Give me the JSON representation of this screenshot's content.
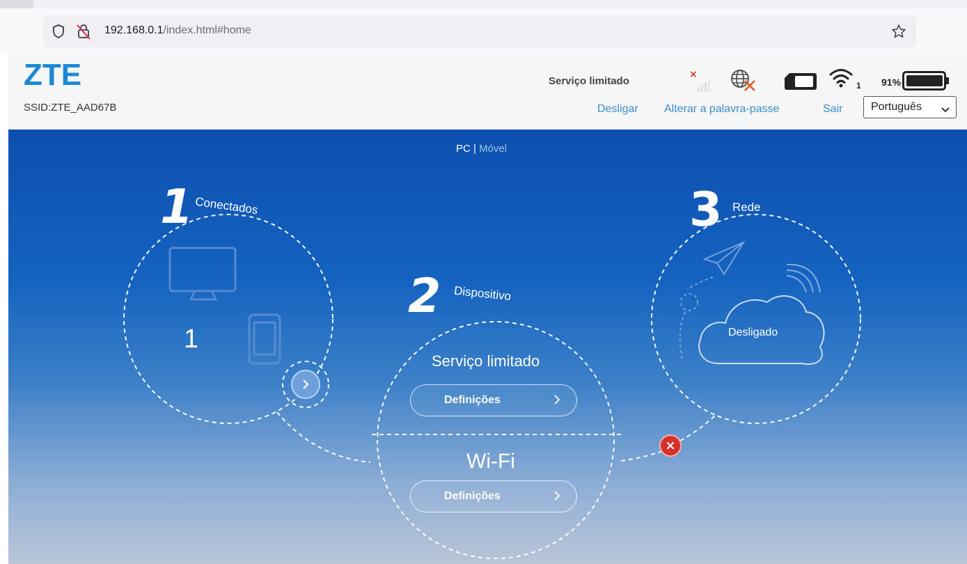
{
  "browser": {
    "url_host": "192.168.0.1",
    "url_path": "/index.html#home"
  },
  "header": {
    "logo": "ZTE",
    "ssid": "SSID:ZTE_AAD67B",
    "network_status": "Serviço limitado",
    "wifi_clients": "1",
    "battery": "91%",
    "links": {
      "disconnect": "Desligar",
      "change_password": "Alterar a palavra-passe",
      "logout": "Sair"
    },
    "language": "Português"
  },
  "view_switch": {
    "pc": "PC",
    "separator": " | ",
    "mobile": "Móvel"
  },
  "steps": {
    "connected": {
      "number": "1",
      "label": "Conectados",
      "count": "1"
    },
    "device": {
      "number": "2",
      "label": "Dispositivo",
      "service_status": "Serviço limitado",
      "service_settings": "Definições",
      "wifi_title": "Wi-Fi",
      "wifi_settings": "Definições"
    },
    "network": {
      "number": "3",
      "label": "Rede",
      "status": "Desligado"
    }
  },
  "colors": {
    "brand": "#1a8ad6",
    "link": "#3a8fd0",
    "error": "#d9302a",
    "background_top": "#0d4fb0"
  },
  "icons": [
    "shield-icon",
    "no-lock-icon",
    "star-icon",
    "no-signal-icon",
    "globe-off-icon",
    "sim-icon",
    "wifi-icon",
    "battery-icon",
    "monitor-icon",
    "phone-icon",
    "paper-plane-icon",
    "cloud-icon",
    "error-icon",
    "chevron-right-icon"
  ]
}
